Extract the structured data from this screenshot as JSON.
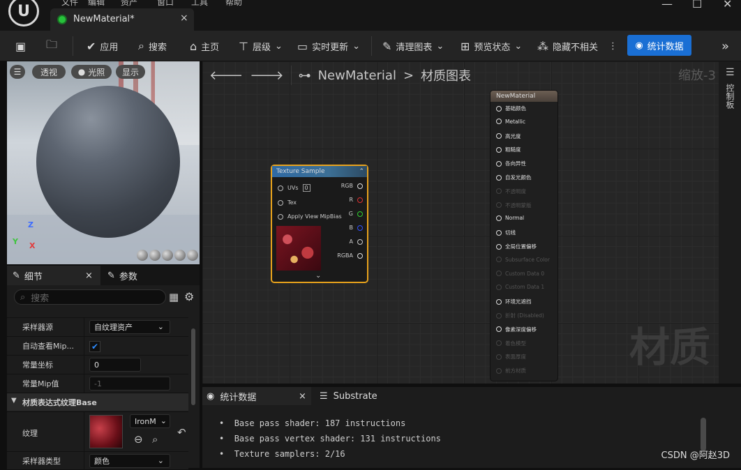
{
  "window": {
    "menu": [
      "文件",
      "编辑",
      "资产",
      "窗口",
      "工具",
      "帮助"
    ],
    "tab_title": "NewMaterial*",
    "tab_close": "×"
  },
  "toolbar": {
    "apply": "应用",
    "search": "搜索",
    "home": "主页",
    "hierarchy": "层级",
    "live_update": "实时更新",
    "clean_graph": "清理图表",
    "preview_state": "预览状态",
    "hide_unrelated": "隐藏不相关",
    "stats": "统计数据",
    "more": "⋮",
    "expand": "»"
  },
  "viewport": {
    "menu_btn": "☰",
    "perspective": "透视",
    "lit": "光照",
    "show": "显示",
    "axis_z": "Z",
    "axis_y": "Y",
    "axis_x": "X"
  },
  "details": {
    "tab_details": "细节",
    "tab_params": "参数",
    "close": "×",
    "search_placeholder": "搜索",
    "rows": {
      "sampler_source_label": "采样器源",
      "sampler_source_value": "自纹理资产",
      "auto_mip_label": "自动查看Mip...",
      "const_coord_label": "常量坐标",
      "const_coord_value": "0",
      "const_mip_label": "常量Mip值",
      "const_mip_value": "-1",
      "section_label": "材质表达式纹理Base",
      "texture_label": "纹理",
      "texture_value": "IronM",
      "sampler_type_label": "采样器类型",
      "sampler_type_value": "颜色"
    }
  },
  "graph": {
    "breadcrumb_asset": "NewMaterial",
    "breadcrumb_sep": ">",
    "breadcrumb_graph": "材质图表",
    "zoom": "缩放-3",
    "watermark": "材质",
    "texture_node": {
      "title": "Texture Sample",
      "inputs": [
        "UVs",
        "Tex",
        "Apply View MipBias"
      ],
      "uv_value": "0",
      "outputs": [
        "RGB",
        "R",
        "G",
        "B",
        "A",
        "RGBA"
      ],
      "output_colors": [
        "#e0e0e0",
        "#e03030",
        "#30d030",
        "#3050ff",
        "#cccccc",
        "#e0e0e0"
      ]
    },
    "material_node": {
      "title": "NewMaterial",
      "pins": [
        {
          "label": "基础颜色",
          "enabled": true
        },
        {
          "label": "Metallic",
          "enabled": true
        },
        {
          "label": "高光度",
          "enabled": true
        },
        {
          "label": "粗糙度",
          "enabled": true
        },
        {
          "label": "各向异性",
          "enabled": true
        },
        {
          "label": "自发光颜色",
          "enabled": true
        },
        {
          "label": "不透明度",
          "enabled": false
        },
        {
          "label": "不透明蒙版",
          "enabled": false
        },
        {
          "label": "Normal",
          "enabled": true
        },
        {
          "label": "切线",
          "enabled": true
        },
        {
          "label": "全局位置偏移",
          "enabled": true
        },
        {
          "label": "Subsurface Color",
          "enabled": false
        },
        {
          "label": "Custom Data 0",
          "enabled": false
        },
        {
          "label": "Custom Data 1",
          "enabled": false
        },
        {
          "label": "环境光遮挡",
          "enabled": true
        },
        {
          "label": "折射 (Disabled)",
          "enabled": false
        },
        {
          "label": "像素深度偏移",
          "enabled": true
        },
        {
          "label": "着色模型",
          "enabled": false
        },
        {
          "label": "表面厚度",
          "enabled": false
        },
        {
          "label": "前方材质",
          "enabled": false
        }
      ]
    },
    "side_panel": "控制板"
  },
  "stats_panel": {
    "tab_stats": "统计数据",
    "tab_substrate": "Substrate",
    "close": "×",
    "lines": [
      "Base pass shader: 187 instructions",
      "Base pass vertex shader: 131 instructions",
      "Texture samplers: 2/16"
    ]
  },
  "watermark_csdn": "CSDN @阿赵3D",
  "colors": {
    "accent": "#1a6fd4",
    "selection": "#e8a21c"
  }
}
